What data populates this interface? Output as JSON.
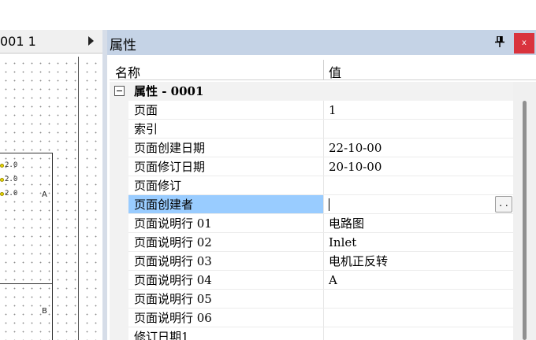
{
  "left_pane": {
    "tab_label": "001 1",
    "zone_labels": [
      "A",
      "B"
    ],
    "pin_labels": [
      "2.0",
      "2.0",
      "2.0"
    ]
  },
  "panel": {
    "title": "属性",
    "close_label": "x",
    "header": {
      "name": "名称",
      "value": "值"
    },
    "category": "属性 - 0001",
    "properties": [
      {
        "name": "页面",
        "value": "1"
      },
      {
        "name": "索引",
        "value": ""
      },
      {
        "name": "页面创建日期",
        "value": "22-10-00"
      },
      {
        "name": "页面修订日期",
        "value": "20-10-00"
      },
      {
        "name": "页面修订",
        "value": ""
      },
      {
        "name": "页面创建者",
        "value": ""
      },
      {
        "name": "页面说明行 01",
        "value": "电路图"
      },
      {
        "name": "页面说明行 02",
        "value": "Inlet"
      },
      {
        "name": "页面说明行 03",
        "value": "电机正反转"
      },
      {
        "name": "页面说明行 04",
        "value": "A"
      },
      {
        "name": "页面说明行 05",
        "value": ""
      },
      {
        "name": "页面说明行 06",
        "value": ""
      },
      {
        "name": "修订日期1",
        "value": ""
      }
    ],
    "ellipsis_label": ". ."
  },
  "colors": {
    "title_bar": "#c5d3e6",
    "selection": "#99ccff",
    "close": "#d9333d"
  }
}
